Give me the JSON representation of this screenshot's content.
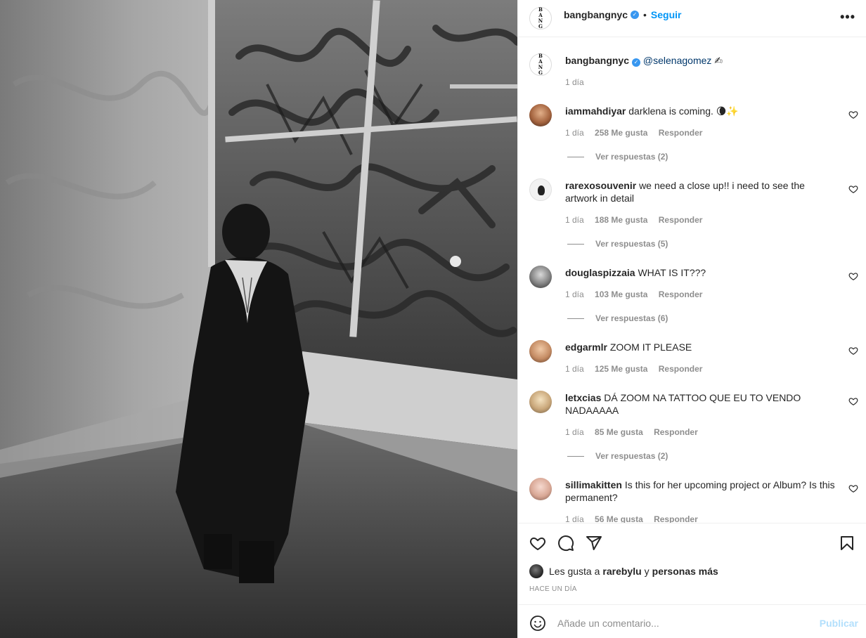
{
  "header": {
    "username": "bangbangnyc",
    "follow_label": "Seguir",
    "more_icon": "more-options-icon",
    "logo_text": "B A N G"
  },
  "caption": {
    "username": "bangbangnyc",
    "mention": "@selenagomez",
    "emoji": "✍",
    "time": "1 día"
  },
  "comments": [
    {
      "username": "iammahdiyar",
      "text": "darklena is coming. 🌘✨",
      "time": "1 día",
      "likes": "258 Me gusta",
      "reply": "Responder",
      "replies": "Ver respuestas (2)"
    },
    {
      "username": "rarexosouvenir",
      "text": "we need a close up!! i need to see the artwork in detail",
      "time": "1 día",
      "likes": "188 Me gusta",
      "reply": "Responder",
      "replies": "Ver respuestas (5)"
    },
    {
      "username": "douglaspizzaia",
      "text": "WHAT IS IT???",
      "time": "1 día",
      "likes": "103 Me gusta",
      "reply": "Responder",
      "replies": "Ver respuestas (6)"
    },
    {
      "username": "edgarmlr",
      "text": "ZOOM IT PLEASE",
      "time": "1 día",
      "likes": "125 Me gusta",
      "reply": "Responder",
      "replies": ""
    },
    {
      "username": "letxcias",
      "text": "DÁ ZOOM NA TATTOO QUE EU TO VENDO NADAAAAA",
      "time": "1 día",
      "likes": "85 Me gusta",
      "reply": "Responder",
      "replies": "Ver respuestas (2)"
    },
    {
      "username": "sillimakitten",
      "text": "Is this for her upcoming project or Album? Is this permanent?",
      "time": "1 día",
      "likes": "56 Me gusta",
      "reply": "Responder",
      "replies": ""
    }
  ],
  "actions": {
    "like_icon": "heart-icon",
    "comment_icon": "comment-icon",
    "share_icon": "share-icon",
    "save_icon": "bookmark-icon"
  },
  "likes": {
    "prefix": "Les gusta a",
    "user": "rarebylu",
    "connector": "y",
    "others": "personas más"
  },
  "post_time": "HACE UN DÍA",
  "add_comment": {
    "placeholder": "Añade un comentario...",
    "publish_label": "Publicar"
  },
  "colors": {
    "accent": "#0095f6",
    "publish_disabled": "#b2dffc",
    "muted": "#8e8e8e",
    "verified": "#3897f0"
  }
}
